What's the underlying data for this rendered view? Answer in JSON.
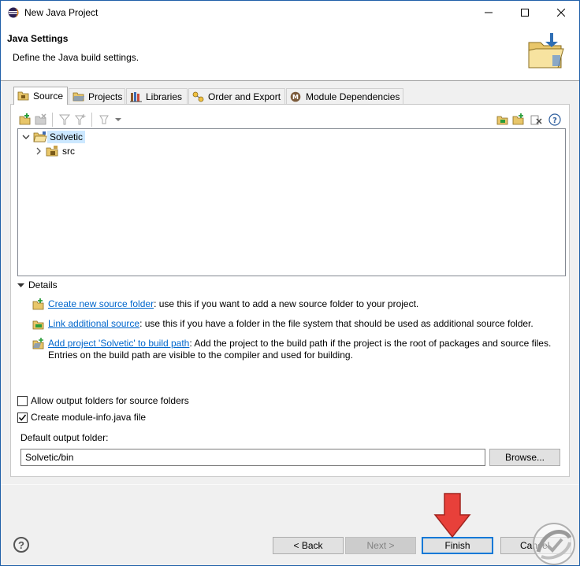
{
  "window": {
    "title": "New Java Project",
    "controls": {
      "minimize_icon": "minimize-icon",
      "maximize_icon": "maximize-icon",
      "close_icon": "close-icon"
    }
  },
  "header": {
    "title": "Java Settings",
    "subtitle": "Define the Java build settings."
  },
  "tabs": [
    {
      "label": "Source",
      "icon": "source-folder-icon",
      "active": true
    },
    {
      "label": "Projects",
      "icon": "projects-icon",
      "active": false
    },
    {
      "label": "Libraries",
      "icon": "libraries-icon",
      "active": false
    },
    {
      "label": "Order and Export",
      "icon": "order-export-icon",
      "active": false
    },
    {
      "label": "Module Dependencies",
      "icon": "module-icon",
      "active": false
    }
  ],
  "tree": {
    "items": [
      {
        "label": "Solvetic",
        "expanded": true,
        "selected": true,
        "icon": "project-folder-icon"
      },
      {
        "label": "src",
        "expanded": false,
        "selected": false,
        "icon": "package-folder-icon"
      }
    ]
  },
  "details": {
    "label": "Details",
    "items": [
      {
        "link": "Create new source folder",
        "text": ": use this if you want to add a new source folder to your project."
      },
      {
        "link": "Link additional source",
        "text": ": use this if you have a folder in the file system that should be used as additional source folder."
      },
      {
        "link": "Add project 'Solvetic' to build path",
        "text": ": Add the project to the build path if the project is the root of packages and source files.",
        "text2": "Entries on the build path are visible to the compiler and used for building."
      }
    ]
  },
  "options": {
    "allow_output_folders": {
      "label": "Allow output folders for source folders",
      "checked": false
    },
    "create_module_info": {
      "label": "Create module-info.java file",
      "checked": true
    }
  },
  "output": {
    "label": "Default output folder:",
    "value": "Solvetic/bin",
    "browse_label": "Browse..."
  },
  "footer": {
    "back_label": "< Back",
    "next_label": "Next >",
    "finish_label": "Finish",
    "cancel_label": "Cancel",
    "help_glyph": "?"
  },
  "colors": {
    "accent": "#0078d7",
    "link": "#0066cc",
    "arrow": "#e8403a",
    "selection": "#cce8ff"
  }
}
